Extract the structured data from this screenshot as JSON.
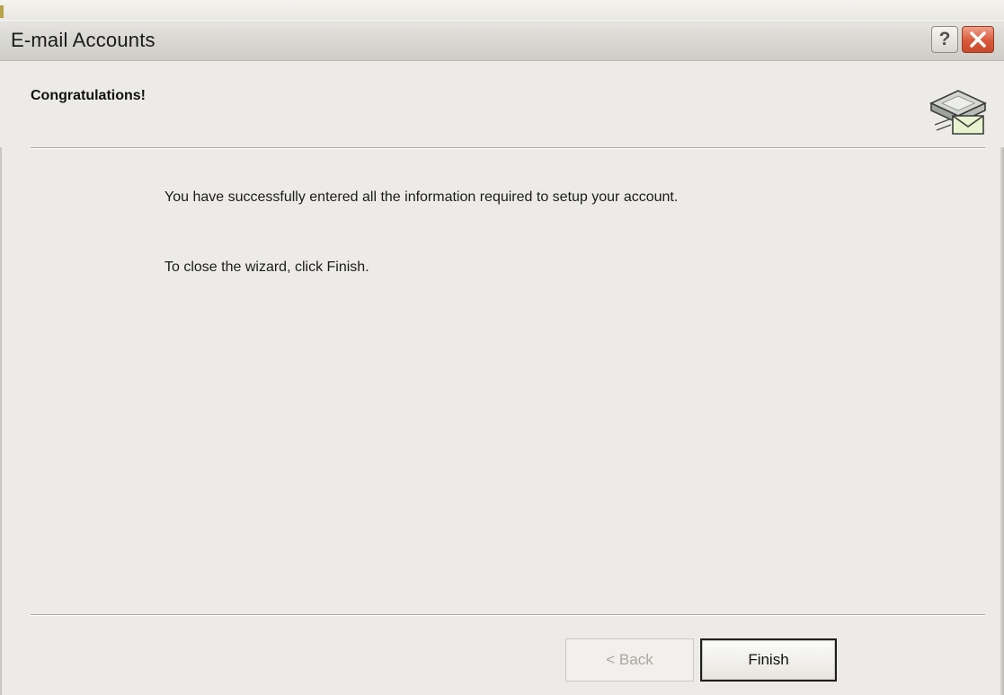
{
  "window": {
    "title": "E-mail Accounts",
    "help_glyph": "?",
    "close_icon": "close-icon"
  },
  "wizard": {
    "header_title": "Congratulations!",
    "header_icon": "email-accounts-icon",
    "message_line1": "You have successfully entered all the information required to setup your account.",
    "message_line2": "To close the wizard, click Finish."
  },
  "buttons": {
    "back_label": "< Back",
    "back_enabled": false,
    "finish_label": "Finish"
  },
  "colors": {
    "close_button": "#d8593a",
    "dialog_background": "#ecebe7"
  }
}
